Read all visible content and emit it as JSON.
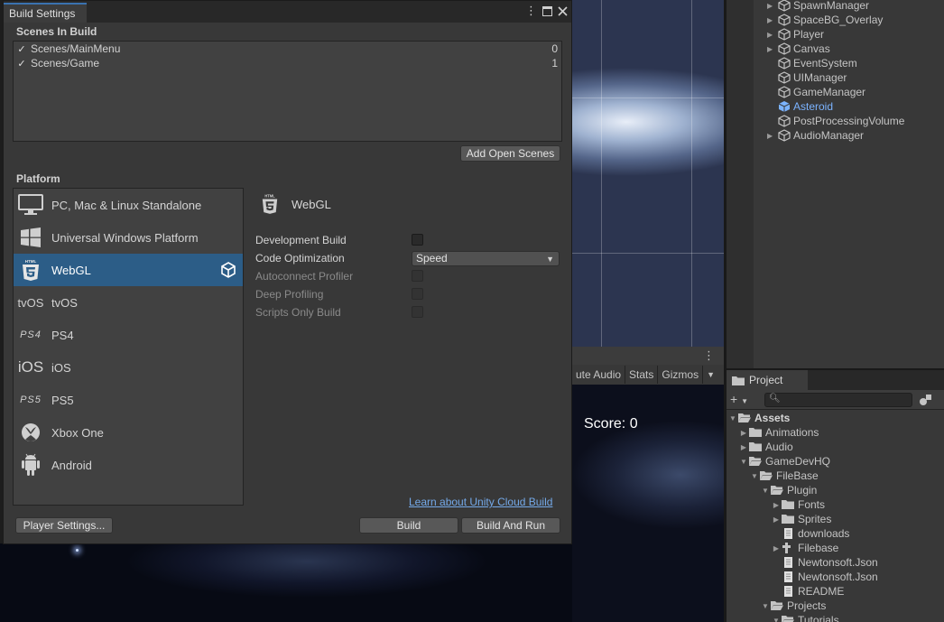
{
  "window": {
    "title": "Build Settings"
  },
  "scenes_in_build": {
    "label": "Scenes In Build",
    "scenes": [
      {
        "name": "Scenes/MainMenu",
        "index": "0",
        "checked": true
      },
      {
        "name": "Scenes/Game",
        "index": "1",
        "checked": true
      }
    ],
    "add_open_scenes_label": "Add Open Scenes"
  },
  "platform": {
    "label": "Platform",
    "items": [
      {
        "name": "PC, Mac & Linux Standalone",
        "icon": "monitor-icon"
      },
      {
        "name": "Universal Windows Platform",
        "icon": "windows-icon"
      },
      {
        "name": "WebGL",
        "icon": "html5-icon",
        "selected": true
      },
      {
        "name": "tvOS",
        "icon": "tvos-icon",
        "logo_text": "tvOS"
      },
      {
        "name": "PS4",
        "icon": "ps4-icon",
        "logo_text": "PS4"
      },
      {
        "name": "iOS",
        "icon": "ios-icon",
        "logo_text": "iOS"
      },
      {
        "name": "PS5",
        "icon": "ps5-icon",
        "logo_text": "PS5"
      },
      {
        "name": "Xbox One",
        "icon": "xbox-icon"
      },
      {
        "name": "Android",
        "icon": "android-icon"
      }
    ]
  },
  "detail": {
    "title": "WebGL",
    "options": [
      {
        "label": "Development Build",
        "enabled": true
      },
      {
        "label": "Code Optimization",
        "enabled": true,
        "value": "Speed"
      },
      {
        "label": "Autoconnect Profiler",
        "enabled": false
      },
      {
        "label": "Deep Profiling",
        "enabled": false
      },
      {
        "label": "Scripts Only Build",
        "enabled": false
      }
    ],
    "cloud_link": "Learn about Unity Cloud Build"
  },
  "footer": {
    "player_settings_label": "Player Settings...",
    "build_label": "Build",
    "build_and_run_label": "Build And Run"
  },
  "game_view": {
    "toolbar": [
      "ute Audio",
      "Stats",
      "Gizmos"
    ],
    "score_text": "Score: 0"
  },
  "hierarchy": {
    "items": [
      {
        "name": "SpawnManager",
        "expandable": true
      },
      {
        "name": "SpaceBG_Overlay",
        "expandable": true
      },
      {
        "name": "Player",
        "expandable": true
      },
      {
        "name": "Canvas",
        "expandable": true
      },
      {
        "name": "EventSystem",
        "expandable": false
      },
      {
        "name": "UIManager",
        "expandable": false
      },
      {
        "name": "GameManager",
        "expandable": false
      },
      {
        "name": "Asteroid",
        "expandable": false,
        "selected": true
      },
      {
        "name": "PostProcessingVolume",
        "expandable": false
      },
      {
        "name": "AudioManager",
        "expandable": true
      }
    ]
  },
  "project": {
    "tab_label": "Project",
    "tree": [
      {
        "name": "Assets",
        "type": "folder",
        "depth": 0,
        "state": "open",
        "bold": true
      },
      {
        "name": "Animations",
        "type": "folder",
        "depth": 1,
        "state": "closed"
      },
      {
        "name": "Audio",
        "type": "folder",
        "depth": 1,
        "state": "closed"
      },
      {
        "name": "GameDevHQ",
        "type": "folder",
        "depth": 1,
        "state": "open"
      },
      {
        "name": "FileBase",
        "type": "folder",
        "depth": 2,
        "state": "open"
      },
      {
        "name": "Plugin",
        "type": "folder",
        "depth": 3,
        "state": "open"
      },
      {
        "name": "Fonts",
        "type": "folder",
        "depth": 4,
        "state": "closed"
      },
      {
        "name": "Sprites",
        "type": "folder",
        "depth": 4,
        "state": "closed"
      },
      {
        "name": "downloads",
        "type": "file",
        "depth": 4,
        "state": "none"
      },
      {
        "name": "Filebase",
        "type": "package",
        "depth": 4,
        "state": "closed"
      },
      {
        "name": "Newtonsoft.Json",
        "type": "file",
        "depth": 4,
        "state": "none"
      },
      {
        "name": "Newtonsoft.Json",
        "type": "file",
        "depth": 4,
        "state": "none"
      },
      {
        "name": "README",
        "type": "file",
        "depth": 4,
        "state": "none"
      },
      {
        "name": "Projects",
        "type": "folder",
        "depth": 3,
        "state": "open"
      },
      {
        "name": "Tutorials",
        "type": "folder",
        "depth": 4,
        "state": "open"
      }
    ]
  },
  "colors": {
    "selection": "#2c5d87",
    "link": "#74a9e8",
    "hierarchy_selected": "#7bb3ff"
  }
}
